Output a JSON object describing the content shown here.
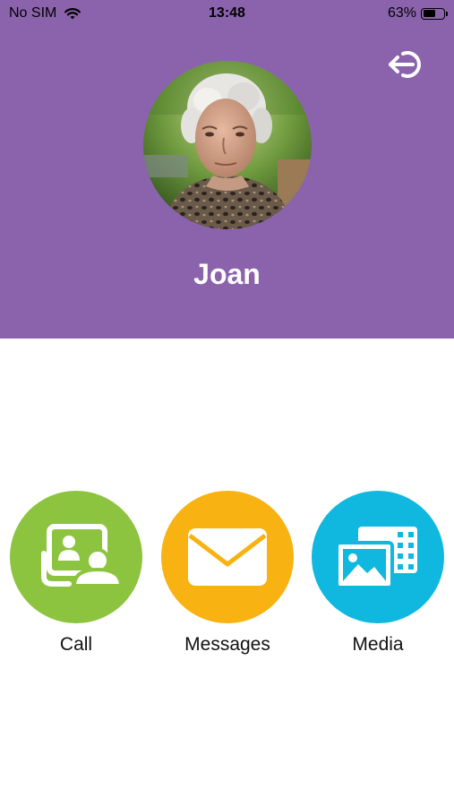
{
  "status_bar": {
    "carrier": "No SIM",
    "time": "13:48",
    "battery_percent": "63%",
    "battery_level": 0.63,
    "wifi_icon": "wifi-icon"
  },
  "header": {
    "background_color": "#8b63ad",
    "logout_icon": "logout-icon",
    "avatar_icon": "user-photo",
    "name": "Joan"
  },
  "actions": [
    {
      "label": "Call",
      "color": "#8dc43f",
      "icon": "video-call-icon"
    },
    {
      "label": "Messages",
      "color": "#f8b212",
      "icon": "envelope-icon"
    },
    {
      "label": "Media",
      "color": "#10b8e0",
      "icon": "media-icon"
    }
  ]
}
